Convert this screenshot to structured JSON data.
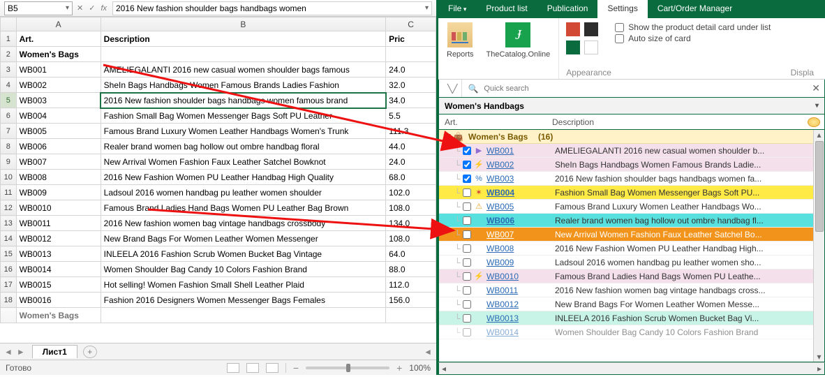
{
  "sheet": {
    "name_box": "B5",
    "fx_cancel": "✕",
    "fx_confirm": "✓",
    "fx_label": "fx",
    "formula": "2016 New fashion shoulder bags handbags women",
    "columns": [
      "A",
      "B",
      "C"
    ],
    "headers": {
      "A": "Art.",
      "B": "Description",
      "C": "Pric"
    },
    "category": "Women's Bags",
    "rows": [
      {
        "n": 3,
        "art": "WB001",
        "desc": "AMELIEGALANTI 2016 new casual women shoulder bags famous",
        "price": "24.0"
      },
      {
        "n": 4,
        "art": "WB002",
        "desc": "SheIn Bags Handbags Women Famous Brands Ladies Fashion",
        "price": "32.0"
      },
      {
        "n": 5,
        "art": "WB003",
        "desc": "2016 New fashion shoulder bags handbags women famous brand",
        "price": "34.0"
      },
      {
        "n": 6,
        "art": "WB004",
        "desc": "Fashion Small Bag Women Messenger Bags Soft PU Leather",
        "price": "5.5"
      },
      {
        "n": 7,
        "art": "WB005",
        "desc": "Famous Brand Luxury Women Leather Handbags Women's Trunk",
        "price": "111.3"
      },
      {
        "n": 8,
        "art": "WB006",
        "desc": "Realer brand women bag hollow out ombre handbag floral",
        "price": "44.0"
      },
      {
        "n": 9,
        "art": "WB007",
        "desc": "New Arrival Women Fashion Faux Leather Satchel Bowknot",
        "price": "24.0"
      },
      {
        "n": 10,
        "art": "WB008",
        "desc": "2016 New Fashion Women PU Leather Handbag High Quality",
        "price": "68.0"
      },
      {
        "n": 11,
        "art": "WB009",
        "desc": "Ladsoul 2016 women handbag pu leather women shoulder",
        "price": "102.0"
      },
      {
        "n": 12,
        "art": "WB0010",
        "desc": "Famous Brand Ladies Hand Bags Women PU Leather Bag Brown",
        "price": "108.0"
      },
      {
        "n": 13,
        "art": "WB0011",
        "desc": "2016 New fashion women bag vintage handbags crossbody",
        "price": "134.0"
      },
      {
        "n": 14,
        "art": "WB0012",
        "desc": "New Brand Bags For Women Leather Women Messenger",
        "price": "108.0"
      },
      {
        "n": 15,
        "art": "WB0013",
        "desc": "INLEELA 2016 Fashion Scrub Women Bucket Bag Vintage",
        "price": "64.0"
      },
      {
        "n": 16,
        "art": "WB0014",
        "desc": "Women Shoulder Bag Candy 10 Colors Fashion Brand",
        "price": "88.0"
      },
      {
        "n": 17,
        "art": "WB0015",
        "desc": "Hot selling! Women Fashion Small Shell Leather Plaid",
        "price": "112.0"
      },
      {
        "n": 18,
        "art": "WB0016",
        "desc": "Fashion 2016 Designers Women Messenger Bags Females",
        "price": "156.0"
      }
    ],
    "category2": "Women's Bags",
    "tab": "Лист1",
    "status": "Готово",
    "zoom": "100%"
  },
  "panel": {
    "tabs": [
      "File",
      "Product list",
      "Publication",
      "Settings",
      "Cart/Order Manager"
    ],
    "active_tab": 3,
    "ribbon": {
      "reports": "Reports",
      "catalog": "TheCatalog.Online",
      "check1": "Show the product detail card under list",
      "check2": "Auto size of card",
      "appearance_label": "Appearance",
      "display_label": "Displa"
    },
    "search_placeholder": "Quick search",
    "category_title": "Women's Handbags",
    "list_headers": {
      "art": "Art.",
      "desc": "Description"
    },
    "group": {
      "label": "Women's Bags",
      "count": "(16)"
    },
    "items": [
      {
        "art": "WB001",
        "desc": "AMELIEGALANTI 2016 new casual women shoulder b...",
        "checked": true,
        "marker": "▶",
        "mcolor": "#8f6fd1",
        "bg": "#f4e0ea"
      },
      {
        "art": "WB002",
        "desc": "SheIn Bags Handbags Women Famous Brands Ladie...",
        "checked": true,
        "marker": "⚡",
        "mcolor": "#e7b93c",
        "bg": "#f4e0ea"
      },
      {
        "art": "WB003",
        "desc": "2016 New fashion shoulder bags handbags women fa...",
        "checked": true,
        "marker": "%",
        "mcolor": "#2b77c4",
        "bg": "#ffffff"
      },
      {
        "art": "WB004",
        "desc": "Fashion Small Bag Women Messenger Bags Soft PU...",
        "checked": false,
        "marker": "✶",
        "mcolor": "#d13a3a",
        "bg": "#ffea46",
        "boldart": true
      },
      {
        "art": "WB005",
        "desc": "Famous Brand Luxury Women Leather Handbags Wo...",
        "checked": false,
        "marker": "⚠",
        "mcolor": "#e1a325",
        "bg": "#ffffff"
      },
      {
        "art": "WB006",
        "desc": "Realer brand women bag hollow out ombre handbag fl...",
        "checked": false,
        "marker": "",
        "mcolor": "",
        "bg": "#57e0de",
        "boldart": true
      },
      {
        "art": "WB007",
        "desc": "New Arrival Women Fashion Faux Leather Satchel Bo...",
        "checked": false,
        "marker": "",
        "mcolor": "",
        "bg": "#f2941c",
        "whitetext": true
      },
      {
        "art": "WB008",
        "desc": "2016 New Fashion Women PU Leather Handbag High...",
        "checked": false,
        "marker": "",
        "mcolor": "",
        "bg": "#ffffff"
      },
      {
        "art": "WB009",
        "desc": "Ladsoul 2016 women handbag pu leather women sho...",
        "checked": false,
        "marker": "",
        "mcolor": "",
        "bg": "#ffffff"
      },
      {
        "art": "WB0010",
        "desc": "Famous Brand Ladies Hand Bags Women PU Leathe...",
        "checked": false,
        "marker": "⚡",
        "mcolor": "#e7b93c",
        "bg": "#f4e0ea"
      },
      {
        "art": "WB0011",
        "desc": "2016 New fashion women bag vintage handbags cross...",
        "checked": false,
        "marker": "",
        "mcolor": "",
        "bg": "#ffffff"
      },
      {
        "art": "WB0012",
        "desc": "New Brand Bags For Women Leather Women Messe...",
        "checked": false,
        "marker": "",
        "mcolor": "",
        "bg": "#ffffff"
      },
      {
        "art": "WB0013",
        "desc": "INLEELA 2016 Fashion Scrub Women Bucket Bag Vi...",
        "checked": false,
        "marker": "",
        "mcolor": "",
        "bg": "#c7f4e7"
      },
      {
        "art": "WB0014",
        "desc": "Women Shoulder Bag Candy 10 Colors Fashion Brand",
        "checked": false,
        "marker": "",
        "mcolor": "",
        "bg": "#ffffff",
        "faded": true
      }
    ]
  }
}
